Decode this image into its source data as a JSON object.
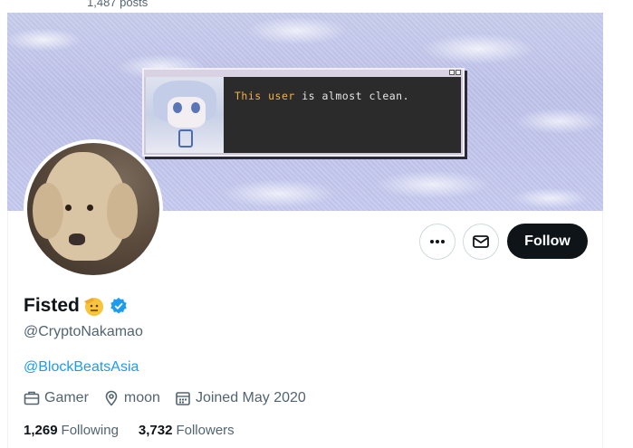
{
  "header": {
    "post_count": "1,487 posts"
  },
  "banner": {
    "terminal_prefix": "This user",
    "terminal_suffix": " is almost clean."
  },
  "actions": {
    "more_icon": "more-horizontal-icon",
    "message_icon": "envelope-icon",
    "follow_label": "Follow"
  },
  "profile": {
    "name": "Fisted",
    "name_emoji": "saluting-face-emoji",
    "verified": true,
    "handle": "@CryptoNakamao",
    "bio_link": "@BlockBeatsAsia",
    "category": "Gamer",
    "location": "moon",
    "joined": "Joined May 2020",
    "following_count": "1,269",
    "following_label": "Following",
    "followers_count": "3,732",
    "followers_label": "Followers"
  },
  "colors": {
    "link": "#1d9bf0",
    "verified": "#1d9bf0",
    "follow_bg": "#0f1419",
    "terminal_highlight": "#f0b24a"
  }
}
